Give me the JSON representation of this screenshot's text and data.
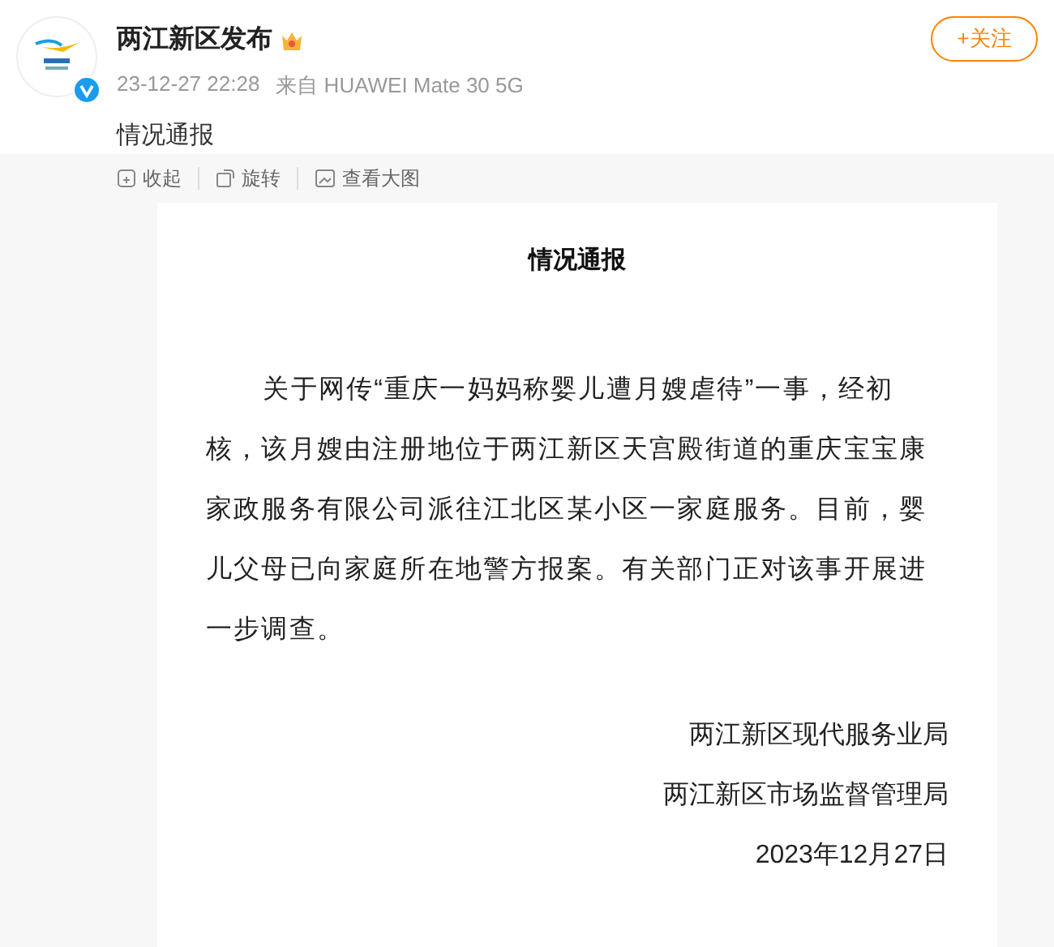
{
  "post": {
    "author": "两江新区发布",
    "verified": true,
    "time": "23-12-27 22:28",
    "source": "来自 HUAWEI Mate 30 5G",
    "text": "情况通报",
    "follow_button": "+关注"
  },
  "image_toolbar": [
    {
      "label": "收起",
      "kind": "collapse"
    },
    {
      "label": "旋转",
      "kind": "rotate"
    },
    {
      "label": "查看大图",
      "kind": "view"
    }
  ],
  "document": {
    "title": "情况通报",
    "paragraph": "关于网传“重庆一妈妈称婴儿遭月嫂虐待”一事，经初核，该月嫂由注册地位于两江新区天宫殿街道的重庆宝宝康家政服务有限公司派往江北区某小区一家庭服务。目前，婴儿父母已向家庭所在地警方报案。有关部门正对该事开展进一步调查。",
    "signatures": [
      "两江新区现代服务业局",
      "两江新区市场监督管理局",
      "2023年12月27日"
    ]
  }
}
